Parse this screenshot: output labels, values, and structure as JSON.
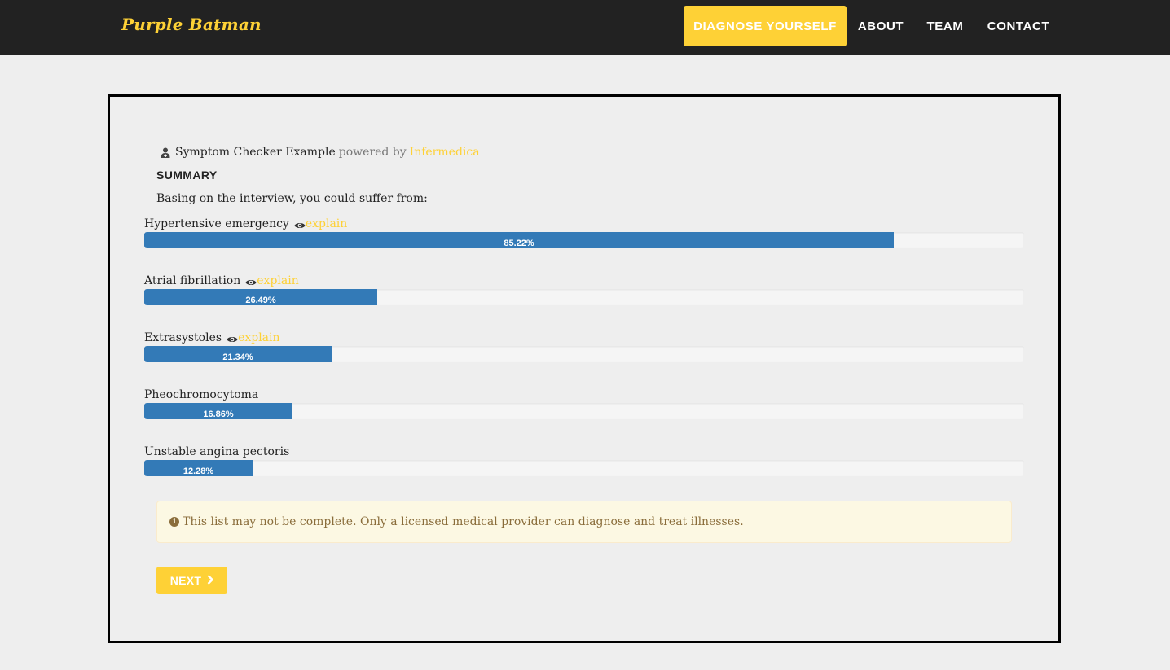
{
  "navbar": {
    "brand": "Purple Batman",
    "items": [
      {
        "label": "DIAGNOSE YOURSELF",
        "active": true
      },
      {
        "label": "ABOUT"
      },
      {
        "label": "TEAM"
      },
      {
        "label": "CONTACT"
      }
    ]
  },
  "header": {
    "icon": "doctor-icon",
    "title": "Symptom Checker Example",
    "powered_by": "powered by",
    "provider": "Infermedica"
  },
  "summary": {
    "title": "SUMMARY",
    "intro": "Basing on the interview, you could suffer from:"
  },
  "conditions": [
    {
      "name": "Hypertensive emergency",
      "explain": "explain",
      "percent_label": "85.22%",
      "fraction": 0.8522
    },
    {
      "name": "Atrial fibrillation",
      "explain": "explain",
      "percent_label": "26.49%",
      "fraction": 0.2649
    },
    {
      "name": "Extrasystoles",
      "explain": "explain",
      "percent_label": "21.34%",
      "fraction": 0.2134
    },
    {
      "name": "Pheochromocytoma",
      "percent_label": "16.86%",
      "fraction": 0.1686
    },
    {
      "name": "Unstable angina pectoris",
      "percent_label": "12.28%",
      "fraction": 0.1228
    }
  ],
  "alert": {
    "icon": "info-circle-icon",
    "text": "This list may not be complete. Only a licensed medical provider can diagnose and treat illnesses."
  },
  "next_button": {
    "label": "NEXT",
    "icon": "chevron-right-icon"
  },
  "colors": {
    "accent": "#fed136",
    "navbar_bg": "#222222",
    "bar": "#337ab7",
    "page_bg": "#eeeeee",
    "alert_bg": "#fcf8e3",
    "alert_text": "#8a6d3b"
  }
}
